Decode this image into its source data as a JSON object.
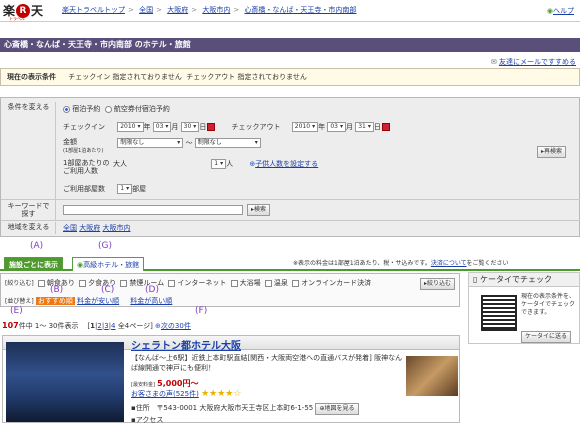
{
  "header": {
    "logo_main": "楽天",
    "logo_sub": "トラベル",
    "breadcrumb": [
      "楽天トラベルトップ",
      "全国",
      "大阪府",
      "大阪市内",
      "心斎橋・なんば・天王寺・市内南部"
    ],
    "help": "ヘルプ"
  },
  "page_title": "心斎橋・なんば・天王寺・市内南部 のホテル・旅館",
  "mail_friend": "友達にメールですすめる",
  "current_conditions": {
    "label": "現在の表示条件",
    "checkin": "チェックイン 指定されておりません",
    "checkout": "チェックアウト 指定されておりません"
  },
  "search": {
    "change_label": "条件を変える",
    "radio_stay": "宿泊予約",
    "radio_air": "航空券付宿泊予約",
    "checkin_label": "チェックイン",
    "checkin": {
      "year": "2010",
      "year_unit": "年",
      "month": "03",
      "month_unit": "月",
      "day": "30",
      "day_unit": "日"
    },
    "checkout_label": "チェックアウト",
    "checkout": {
      "year": "2010",
      "year_unit": "年",
      "month": "03",
      "month_unit": "月",
      "day": "31",
      "day_unit": "日"
    },
    "price_label": "金額",
    "price_note": "(1部屋1泊あたり)",
    "price_min": "制限なし",
    "price_tilde": "〜",
    "price_max": "制限なし",
    "guests_label1": "1部屋あたりの",
    "guests_label2": "ご利用人数",
    "adult_label": "大人",
    "adult_count": "1",
    "adult_unit": "人",
    "child_link": "子供人数を設定する",
    "rooms_label": "ご利用部屋数",
    "rooms_count": "1",
    "rooms_unit": "部屋",
    "research_button": "再検索",
    "keyword_label1": "キーワードで",
    "keyword_label2": "探す",
    "keyword_button": "検索",
    "keyword_placeholder": "",
    "area_label": "地域を変える",
    "area_links": [
      "全国",
      "大阪府",
      "大阪市内"
    ]
  },
  "annotations": [
    "(A)",
    "(G)",
    "(B)",
    "(C)",
    "(D)",
    "(E)",
    "(F)"
  ],
  "tabs": {
    "by_facility": "施設ごとに表示",
    "premium": "高級ホテル・旅館"
  },
  "fee_note": "※表示の料金は1部屋1泊あたり、税・サ込みです。",
  "fee_link": "決済について",
  "fee_suffix": "をご覧ください",
  "filters": {
    "label1": "[絞り込む]",
    "options": [
      "朝食あり",
      "夕食あり",
      "禁煙ルーム",
      "インターネット",
      "大浴場",
      "温泉",
      "オンラインカード決済"
    ],
    "narrow_button": "絞り込む",
    "label2": "[並び替え]",
    "sort_recommended": "おすすめ順",
    "sort_cheap": "料金が安い順",
    "sort_expensive": "料金が高い順"
  },
  "mobile": {
    "title": "ケータイでチェック",
    "text": "現在の表示条件を、ケータイでチェックできます。",
    "button": "ケータイに送る"
  },
  "results": {
    "count": "107",
    "count_suffix": "件中 1〜 30件表示",
    "pages": [
      "1",
      "2",
      "3",
      "4"
    ],
    "page_total": "全4ページ",
    "next": "次の30件"
  },
  "hotel": {
    "name": "シェラトン都ホテル大阪",
    "desc": "【なんば〜上6駅】近鉄上本町駅直結[関西・大阪両空港への直通バスが発着] 阪神なんば線開通で神戸にも便利！",
    "price_label": "[最安料金]",
    "price": "5,000円〜",
    "reviews": "お客さまの声(525件)",
    "addr_label": "住所",
    "addr": "〒543-0001 大阪府大阪市天王寺区上本町6-1-55",
    "map_button": "地図を見る",
    "access_label": "アクセス"
  }
}
